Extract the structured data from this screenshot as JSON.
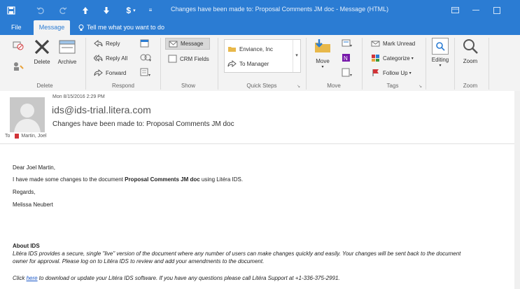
{
  "window": {
    "title": "Changes have been made to: Proposal Comments JM doc - Message (HTML)",
    "accent": "#2b7cd3"
  },
  "qat": {
    "icons": [
      "save-icon",
      "undo-icon",
      "redo-icon",
      "up-arrow-icon",
      "down-arrow-icon",
      "dollar-icon",
      "customize-icon"
    ]
  },
  "tabs": {
    "file": "File",
    "message": "Message",
    "tell_me": "Tell me what you want to do"
  },
  "ribbon": {
    "delete": {
      "label": "Delete",
      "delete_btn": "Delete",
      "archive_btn": "Archive"
    },
    "respond": {
      "label": "Respond",
      "reply": "Reply",
      "reply_all": "Reply All",
      "forward": "Forward"
    },
    "show": {
      "label": "Show",
      "message": "Message",
      "crm_fields": "CRM Fields"
    },
    "quick_steps": {
      "label": "Quick Steps",
      "step1": "Enviance, Inc",
      "step2": "To Manager"
    },
    "move": {
      "label": "Move",
      "move_btn": "Move"
    },
    "tags": {
      "label": "Tags",
      "mark_unread": "Mark Unread",
      "categorize": "Categorize",
      "follow_up": "Follow Up"
    },
    "editing": {
      "label": "Editing"
    },
    "zoom": {
      "label": "Zoom",
      "zoom_btn": "Zoom"
    }
  },
  "email": {
    "date": "Mon 8/15/2016 2:29 PM",
    "from": "ids@ids-trial.litera.com",
    "subject": "Changes have been made to: Proposal Comments JM doc",
    "to_label": "To",
    "to_name": "Martin, Joel",
    "greeting": "Dear Joel Martin,",
    "line1_a": "I have made some changes to the document ",
    "line1_doc": "Proposal Comments JM doc",
    "line1_b": " using Litéra IDS.",
    "regards": "Regards,",
    "signature": "Melissa Neubert",
    "about_title": "About IDS",
    "about_line1": "Litéra IDS provides a secure, single \"live\" version of the document where any number of users can make changes quickly and easily. Your changes will be sent back to the document",
    "about_line2": "owner for approval. Please log on to Litéra IDS to review and add your amendments to the document.",
    "click_a": "Click ",
    "click_link": "here",
    "click_b": " to download or update your Litéra IDS software. If you have any questions please call Litéra Support at +1-336-375-2991."
  }
}
